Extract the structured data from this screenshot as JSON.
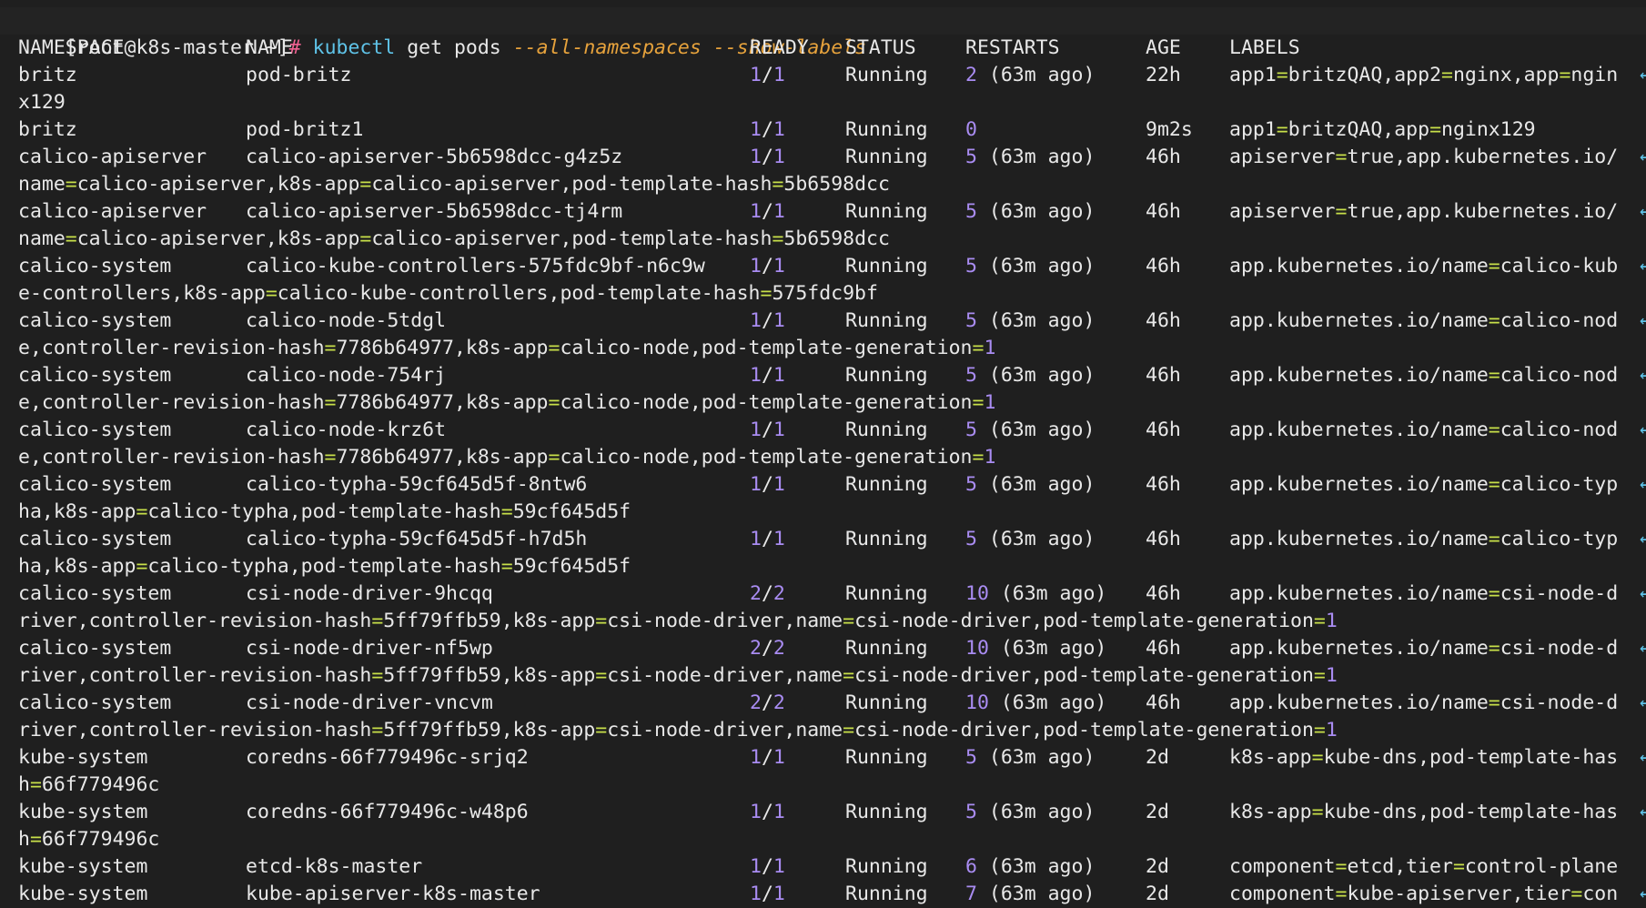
{
  "prompt": {
    "user_host": "[root@k8s-master ~]",
    "symbol": "#",
    "cmd": "kubectl",
    "args": "get pods",
    "flags": "--all-namespaces --show-labels"
  },
  "headers": {
    "ns": "NAMESPACE",
    "name": "NAME",
    "ready": "READY",
    "status": "STATUS",
    "restarts": "RESTARTS",
    "age": "AGE",
    "labels": "LABELS"
  },
  "wrap_marker": "↩",
  "rows": [
    {
      "ns": "britz",
      "name": "pod-britz",
      "ready": "1/1",
      "status": "Running",
      "restarts": "2 (63m ago)",
      "age": "22h",
      "labels": "app1=britzQAQ,app2=nginx,app=ngin",
      "cont": "x129",
      "wrapped": true
    },
    {
      "ns": "britz",
      "name": "pod-britz1",
      "ready": "1/1",
      "status": "Running",
      "restarts": "0",
      "age": "9m2s",
      "labels": "app1=britzQAQ,app=nginx129",
      "cont": "",
      "wrapped": false
    },
    {
      "ns": "calico-apiserver",
      "name": "calico-apiserver-5b6598dcc-g4z5z",
      "ready": "1/1",
      "status": "Running",
      "restarts": "5 (63m ago)",
      "age": "46h",
      "labels": "apiserver=true,app.kubernetes.io/",
      "cont": "name=calico-apiserver,k8s-app=calico-apiserver,pod-template-hash=5b6598dcc",
      "wrapped": true
    },
    {
      "ns": "calico-apiserver",
      "name": "calico-apiserver-5b6598dcc-tj4rm",
      "ready": "1/1",
      "status": "Running",
      "restarts": "5 (63m ago)",
      "age": "46h",
      "labels": "apiserver=true,app.kubernetes.io/",
      "cont": "name=calico-apiserver,k8s-app=calico-apiserver,pod-template-hash=5b6598dcc",
      "wrapped": true
    },
    {
      "ns": "calico-system",
      "name": "calico-kube-controllers-575fdc9bf-n6c9w",
      "ready": "1/1",
      "status": "Running",
      "restarts": "5 (63m ago)",
      "age": "46h",
      "labels": "app.kubernetes.io/name=calico-kub",
      "cont": "e-controllers,k8s-app=calico-kube-controllers,pod-template-hash=575fdc9bf",
      "wrapped": true
    },
    {
      "ns": "calico-system",
      "name": "calico-node-5tdgl",
      "ready": "1/1",
      "status": "Running",
      "restarts": "5 (63m ago)",
      "age": "46h",
      "labels": "app.kubernetes.io/name=calico-nod",
      "cont": "e,controller-revision-hash=7786b64977,k8s-app=calico-node,pod-template-generation=1",
      "wrapped": true
    },
    {
      "ns": "calico-system",
      "name": "calico-node-754rj",
      "ready": "1/1",
      "status": "Running",
      "restarts": "5 (63m ago)",
      "age": "46h",
      "labels": "app.kubernetes.io/name=calico-nod",
      "cont": "e,controller-revision-hash=7786b64977,k8s-app=calico-node,pod-template-generation=1",
      "wrapped": true
    },
    {
      "ns": "calico-system",
      "name": "calico-node-krz6t",
      "ready": "1/1",
      "status": "Running",
      "restarts": "5 (63m ago)",
      "age": "46h",
      "labels": "app.kubernetes.io/name=calico-nod",
      "cont": "e,controller-revision-hash=7786b64977,k8s-app=calico-node,pod-template-generation=1",
      "wrapped": true
    },
    {
      "ns": "calico-system",
      "name": "calico-typha-59cf645d5f-8ntw6",
      "ready": "1/1",
      "status": "Running",
      "restarts": "5 (63m ago)",
      "age": "46h",
      "labels": "app.kubernetes.io/name=calico-typ",
      "cont": "ha,k8s-app=calico-typha,pod-template-hash=59cf645d5f",
      "wrapped": true
    },
    {
      "ns": "calico-system",
      "name": "calico-typha-59cf645d5f-h7d5h",
      "ready": "1/1",
      "status": "Running",
      "restarts": "5 (63m ago)",
      "age": "46h",
      "labels": "app.kubernetes.io/name=calico-typ",
      "cont": "ha,k8s-app=calico-typha,pod-template-hash=59cf645d5f",
      "wrapped": true
    },
    {
      "ns": "calico-system",
      "name": "csi-node-driver-9hcqq",
      "ready": "2/2",
      "status": "Running",
      "restarts": "10 (63m ago)",
      "age": "46h",
      "labels": "app.kubernetes.io/name=csi-node-d",
      "cont": "river,controller-revision-hash=5ff79ffb59,k8s-app=csi-node-driver,name=csi-node-driver,pod-template-generation=1",
      "wrapped": true
    },
    {
      "ns": "calico-system",
      "name": "csi-node-driver-nf5wp",
      "ready": "2/2",
      "status": "Running",
      "restarts": "10 (63m ago)",
      "age": "46h",
      "labels": "app.kubernetes.io/name=csi-node-d",
      "cont": "river,controller-revision-hash=5ff79ffb59,k8s-app=csi-node-driver,name=csi-node-driver,pod-template-generation=1",
      "wrapped": true
    },
    {
      "ns": "calico-system",
      "name": "csi-node-driver-vncvm",
      "ready": "2/2",
      "status": "Running",
      "restarts": "10 (63m ago)",
      "age": "46h",
      "labels": "app.kubernetes.io/name=csi-node-d",
      "cont": "river,controller-revision-hash=5ff79ffb59,k8s-app=csi-node-driver,name=csi-node-driver,pod-template-generation=1",
      "wrapped": true
    },
    {
      "ns": "kube-system",
      "name": "coredns-66f779496c-srjq2",
      "ready": "1/1",
      "status": "Running",
      "restarts": "5 (63m ago)",
      "age": "2d",
      "labels": "k8s-app=kube-dns,pod-template-has",
      "cont": "h=66f779496c",
      "wrapped": true
    },
    {
      "ns": "kube-system",
      "name": "coredns-66f779496c-w48p6",
      "ready": "1/1",
      "status": "Running",
      "restarts": "5 (63m ago)",
      "age": "2d",
      "labels": "k8s-app=kube-dns,pod-template-has",
      "cont": "h=66f779496c",
      "wrapped": true
    },
    {
      "ns": "kube-system",
      "name": "etcd-k8s-master",
      "ready": "1/1",
      "status": "Running",
      "restarts": "6 (63m ago)",
      "age": "2d",
      "labels": "component=etcd,tier=control-plane",
      "cont": "",
      "wrapped": false
    },
    {
      "ns": "kube-system",
      "name": "kube-apiserver-k8s-master",
      "ready": "1/1",
      "status": "Running",
      "restarts": "7 (63m ago)",
      "age": "2d",
      "labels": "component=kube-apiserver,tier=con",
      "cont": "",
      "wrapped": true
    }
  ]
}
